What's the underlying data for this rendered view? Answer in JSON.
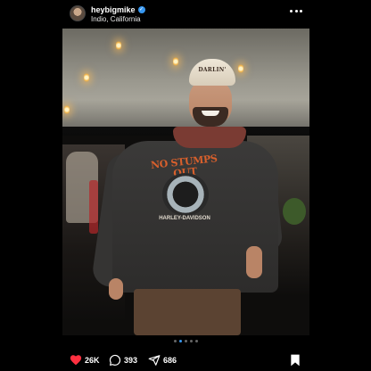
{
  "post": {
    "username": "heybigmike",
    "verified": true,
    "location": "Indio, California",
    "menu_icon": "more-horizontal-icon"
  },
  "photo": {
    "cap_text": "DARLIN'",
    "shirt_print_title": "NO STUMPS OUT",
    "shirt_print_sub": "HARLEY-DAVIDSON"
  },
  "carousel": {
    "total": 5,
    "active_index": 1,
    "active_color": "#3797f0"
  },
  "actions": {
    "likes": "26K",
    "comments": "393",
    "shares": "686",
    "like_icon": "heart-filled-icon",
    "like_color": "#ff3040",
    "comment_icon": "comment-icon",
    "share_icon": "send-icon",
    "save_icon": "bookmark-filled-icon"
  }
}
